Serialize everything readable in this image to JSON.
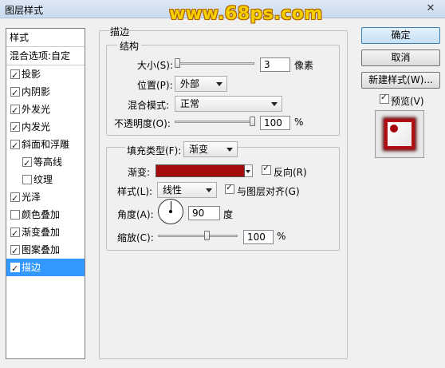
{
  "window": {
    "title": "图层样式",
    "close_icon": "close-icon",
    "watermark": "www.68ps.com"
  },
  "style_list": {
    "header": "样式",
    "blend_options": "混合选项:自定",
    "items": [
      {
        "label": "投影",
        "checked": true
      },
      {
        "label": "内阴影",
        "checked": true
      },
      {
        "label": "外发光",
        "checked": true
      },
      {
        "label": "内发光",
        "checked": true
      },
      {
        "label": "斜面和浮雕",
        "checked": true
      },
      {
        "label": "等高线",
        "checked": true
      },
      {
        "label": "纹理",
        "checked": false
      },
      {
        "label": "光泽",
        "checked": true
      },
      {
        "label": "颜色叠加",
        "checked": false
      },
      {
        "label": "渐变叠加",
        "checked": true
      },
      {
        "label": "图案叠加",
        "checked": true
      },
      {
        "label": "描边",
        "checked": true,
        "selected": true
      }
    ]
  },
  "stroke": {
    "section_title": "描边",
    "structure": {
      "title": "结构",
      "size_label": "大小(S):",
      "size_value": "3",
      "size_unit": "像素",
      "position_label": "位置(P):",
      "position_value": "外部",
      "blend_label": "混合模式:",
      "blend_value": "正常",
      "opacity_label": "不透明度(O):",
      "opacity_value": "100",
      "opacity_unit": "%"
    },
    "fill": {
      "fill_type_label": "填充类型(F):",
      "fill_type_value": "渐变",
      "gradient_label": "渐变:",
      "gradient_color": "#a50d0d",
      "reverse_label": "反向(R)",
      "reverse_checked": true,
      "style_label": "样式(L):",
      "style_value": "线性",
      "align_label": "与图层对齐(G)",
      "align_checked": true,
      "angle_label": "角度(A):",
      "angle_value": "90",
      "angle_unit": "度",
      "scale_label": "缩放(C):",
      "scale_value": "100",
      "scale_unit": "%"
    }
  },
  "buttons": {
    "ok": "确定",
    "cancel": "取消",
    "new_style": "新建样式(W)...",
    "preview_label": "预览(V)",
    "preview_checked": true
  },
  "colors": {
    "selection": "#3399ff",
    "stroke_red": "#b00e12"
  }
}
